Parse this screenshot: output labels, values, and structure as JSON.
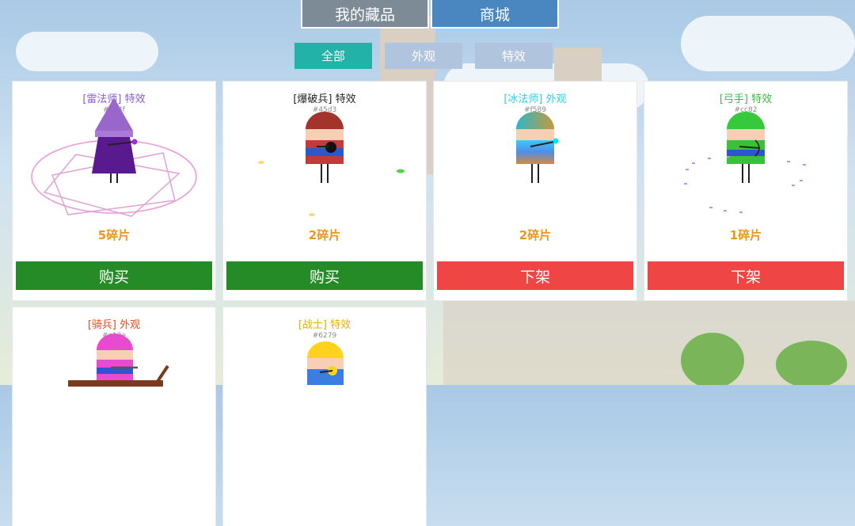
{
  "main_tabs": {
    "collection": "我的藏品",
    "shop": "商城"
  },
  "filters": {
    "all": "全部",
    "skin": "外观",
    "effect": "特效"
  },
  "cards": [
    {
      "tag": "[雷法师]",
      "type": "特效",
      "code": "#e44f",
      "price": "5碎片",
      "action": "购买",
      "color": "#8a5ad0"
    },
    {
      "tag": "[爆破兵]",
      "type": "特效",
      "code": "#45d3",
      "price": "2碎片",
      "action": "购买",
      "color": "#222222"
    },
    {
      "tag": "[冰法师]",
      "type": "外观",
      "code": "#f589",
      "price": "2碎片",
      "action": "下架",
      "color": "#22d3e6"
    },
    {
      "tag": "[弓手]",
      "type": "特效",
      "code": "#cc82",
      "price": "1碎片",
      "action": "下架",
      "color": "#3bbf3b"
    },
    {
      "tag": "[骑兵]",
      "type": "外观",
      "code": "#e13e",
      "price": "",
      "action": "",
      "color": "#ea4b1f"
    },
    {
      "tag": "[战士]",
      "type": "特效",
      "code": "#6279",
      "price": "",
      "action": "",
      "color": "#e8b000"
    }
  ]
}
